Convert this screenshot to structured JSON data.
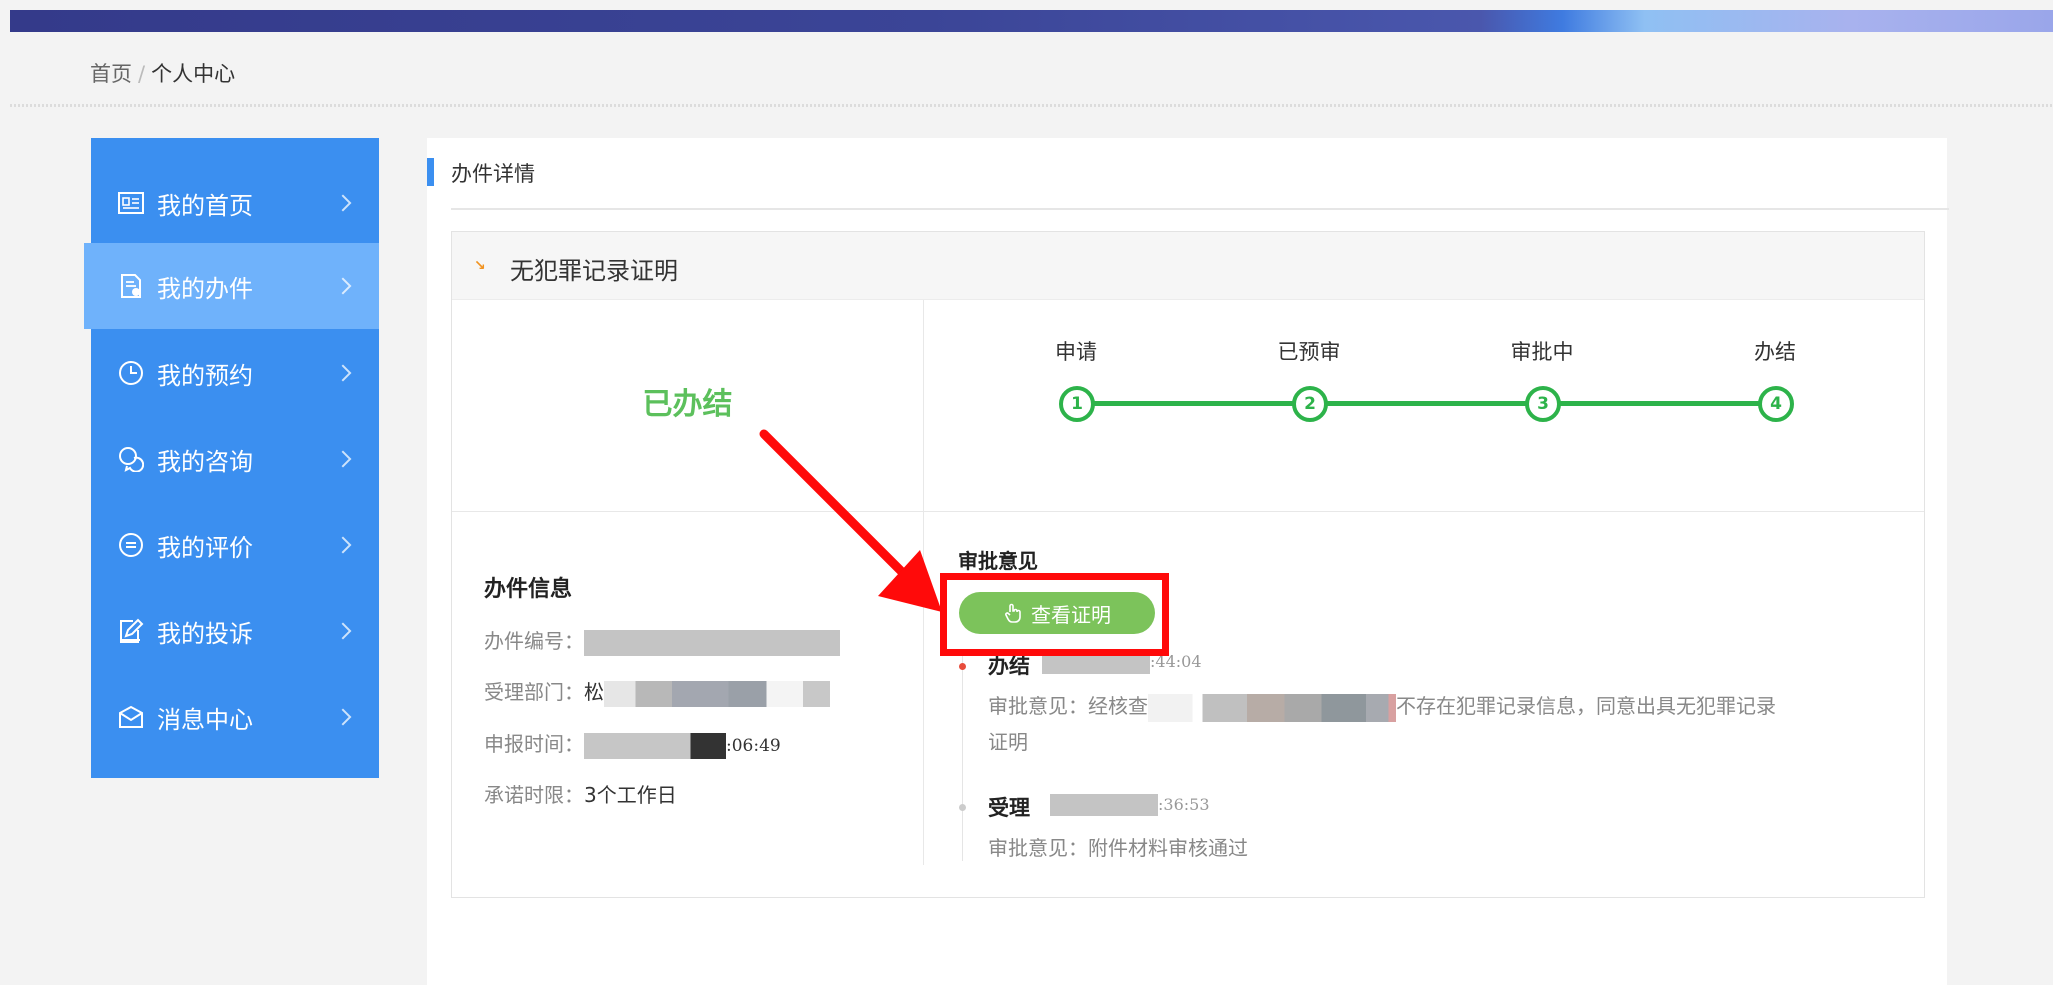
{
  "breadcrumb": {
    "home": "首页",
    "separator": "/",
    "current": "个人中心"
  },
  "sidebar": {
    "items": [
      {
        "label": "我的首页",
        "icon": "home-card-icon"
      },
      {
        "label": "我的办件",
        "icon": "document-stamp-icon",
        "active": true
      },
      {
        "label": "我的预约",
        "icon": "clock-icon"
      },
      {
        "label": "我的咨询",
        "icon": "chat-bubbles-icon"
      },
      {
        "label": "我的评价",
        "icon": "comment-icon"
      },
      {
        "label": "我的投诉",
        "icon": "complaint-edit-icon"
      },
      {
        "label": "消息中心",
        "icon": "envelope-icon"
      }
    ]
  },
  "panel": {
    "title": "办件详情"
  },
  "case": {
    "title": "无犯罪记录证明",
    "status": "已办结",
    "steps": [
      {
        "label": "申请",
        "num": "1"
      },
      {
        "label": "已预审",
        "num": "2"
      },
      {
        "label": "审批中",
        "num": "3"
      },
      {
        "label": "办结",
        "num": "4"
      }
    ]
  },
  "info": {
    "title": "办件信息",
    "number_label": "办件编号：",
    "dept_label": "受理部门：",
    "dept_value": "松",
    "time_label": "申报时间：",
    "time_value": ":06:49",
    "deadline_label": "承诺时限：",
    "deadline_value": "3个工作日"
  },
  "opinions": {
    "title": "审批意见",
    "view_button": "查看证明",
    "entries": [
      {
        "label": "办结",
        "time": ":44:04",
        "text_prefix": "审批意见：经核查",
        "text_suffix": "不存在犯罪记录信息，同意出具无犯罪记录",
        "text_line2": "证明"
      },
      {
        "label": "受理",
        "time": ":36:53",
        "text": "审批意见：附件材料审核通过"
      }
    ]
  },
  "colors": {
    "sidebar": "#3b8ff0",
    "sidebar_active": "#6fb2fb",
    "progress_green": "#2db34a",
    "status_green": "#5cc05c",
    "button_green": "#7cc35b",
    "annotation_red": "#ff0a0a"
  }
}
